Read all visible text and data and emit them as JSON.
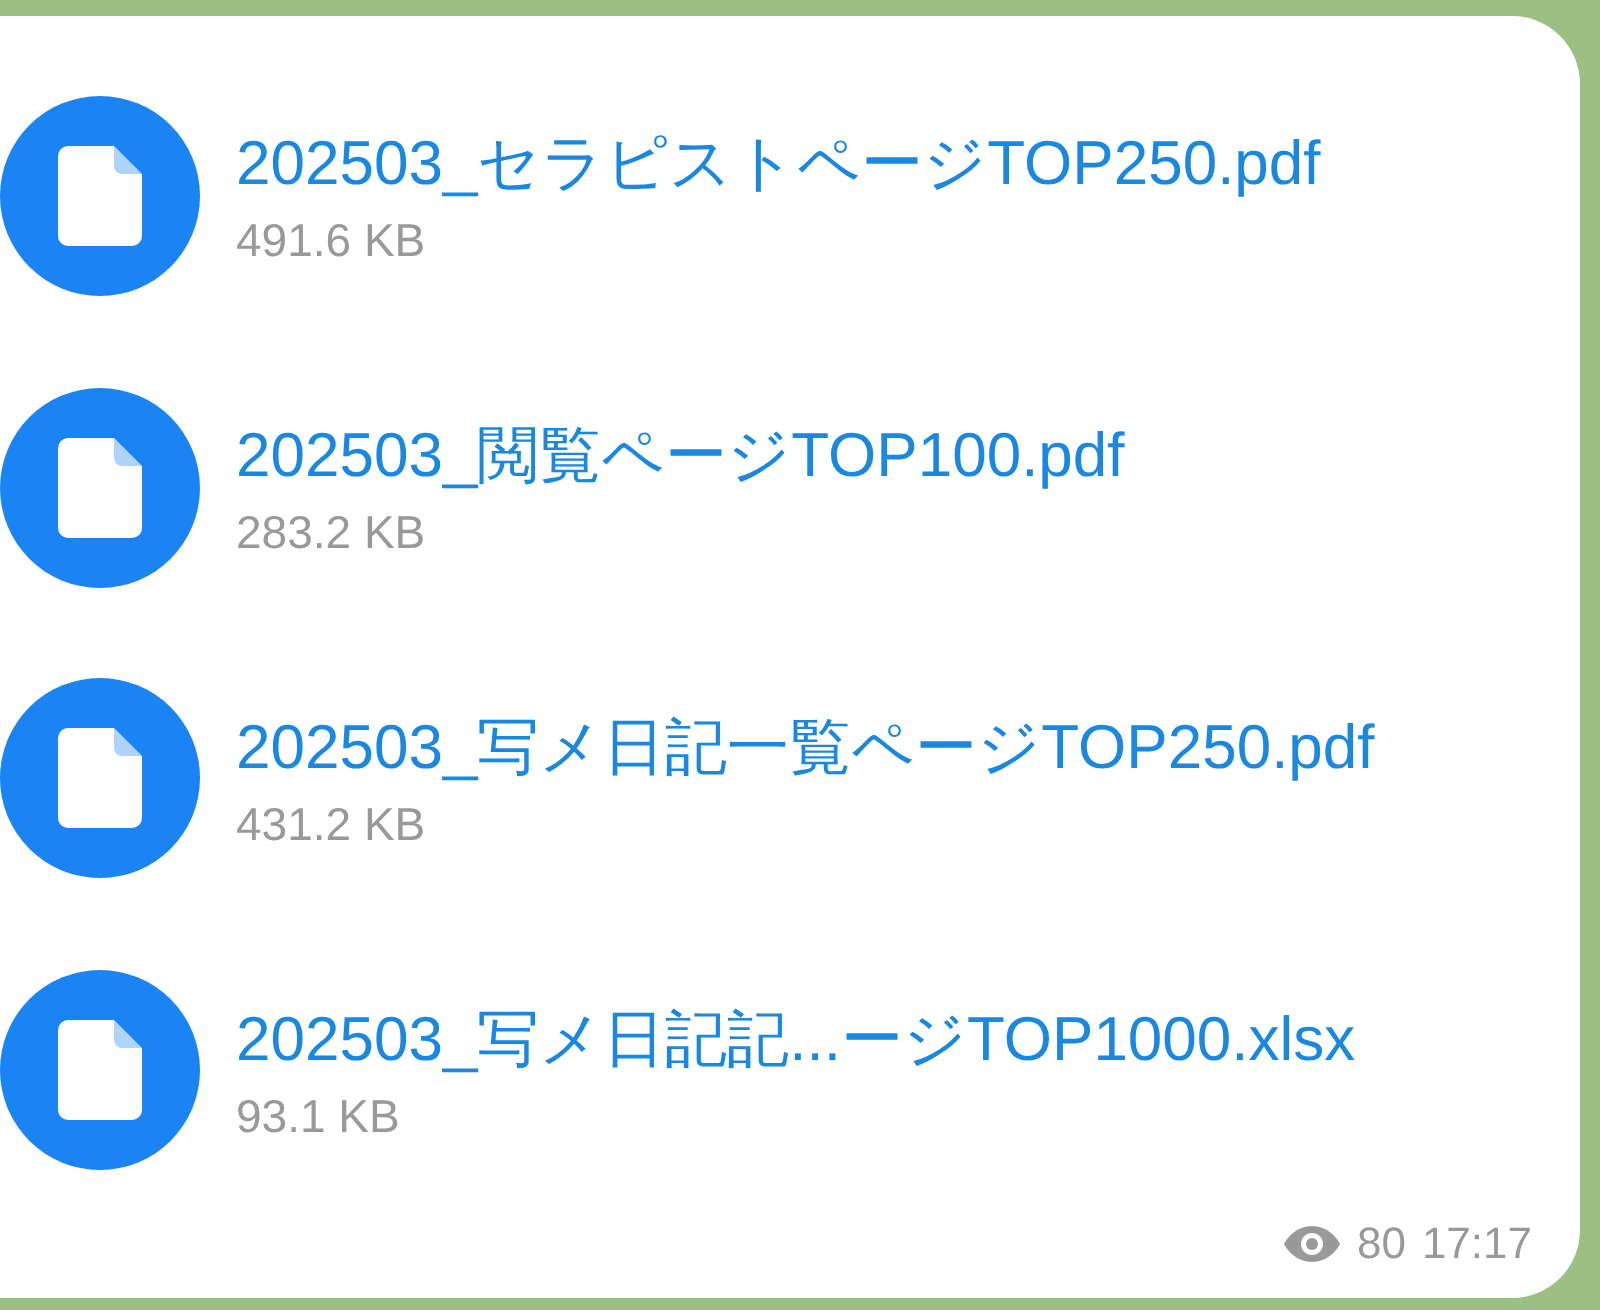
{
  "files": [
    {
      "name": "202503_セラピストページTOP250.pdf",
      "size": "491.6 KB"
    },
    {
      "name": "202503_閲覧ページTOP100.pdf",
      "size": "283.2 KB"
    },
    {
      "name": "202503_写メ日記一覧ページTOP250.pdf",
      "size": "431.2 KB"
    },
    {
      "name": "202503_写メ日記記...ージTOP1000.xlsx",
      "size": "93.1 KB"
    }
  ],
  "footer": {
    "views": "80",
    "time": "17:17"
  }
}
